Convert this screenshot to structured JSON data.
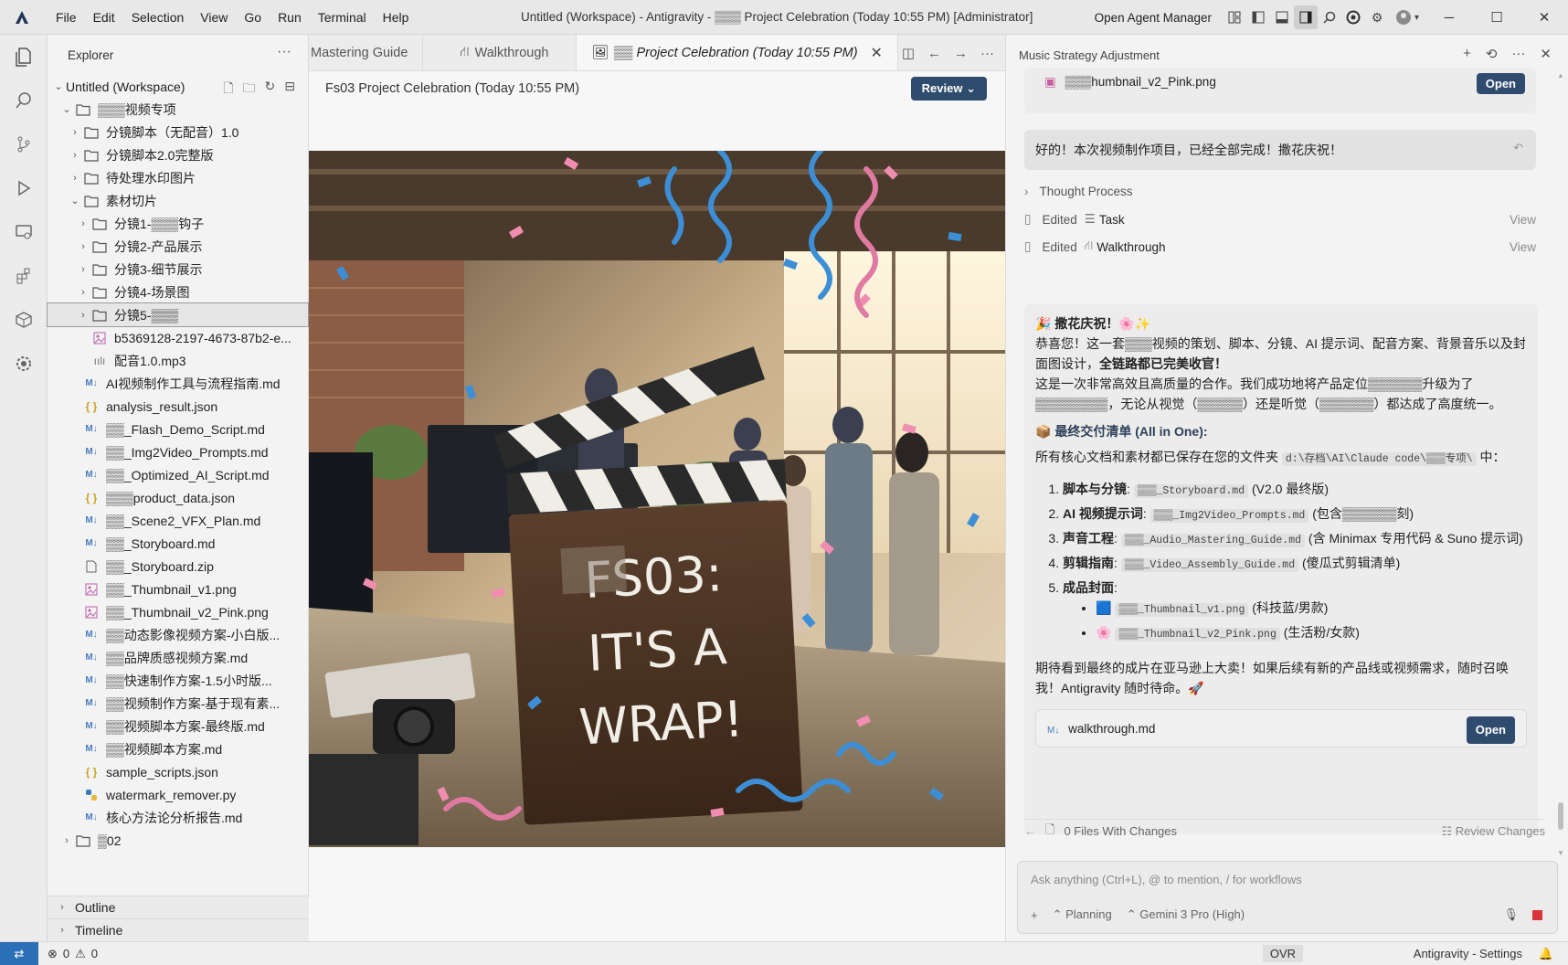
{
  "app": {
    "window_title": "Untitled (Workspace) - Antigravity - ▒▒▒ Project Celebration (Today 10:55 PM) [Administrator]",
    "menu": [
      "File",
      "Edit",
      "Selection",
      "View",
      "Go",
      "Run",
      "Terminal",
      "Help"
    ],
    "open_agent_manager": "Open Agent Manager"
  },
  "explorer": {
    "title": "Explorer",
    "workspace": "Untitled (Workspace)",
    "items": [
      {
        "label": "▒▒▒视频专项",
        "depth": 1,
        "kind": "folder",
        "open": true
      },
      {
        "label": "分镜脚本（无配音）1.0",
        "depth": 2,
        "kind": "folder"
      },
      {
        "label": "分镜脚本2.0完整版",
        "depth": 2,
        "kind": "folder"
      },
      {
        "label": "待处理水印图片",
        "depth": 2,
        "kind": "folder"
      },
      {
        "label": "素材切片",
        "depth": 2,
        "kind": "folder",
        "open": true
      },
      {
        "label": "分镜1-▒▒▒钩子",
        "depth": 3,
        "kind": "folder"
      },
      {
        "label": "分镜2-产品展示",
        "depth": 3,
        "kind": "folder"
      },
      {
        "label": "分镜3-细节展示",
        "depth": 3,
        "kind": "folder"
      },
      {
        "label": "分镜4-场景图",
        "depth": 3,
        "kind": "folder"
      },
      {
        "label": "分镜5-▒▒▒",
        "depth": 3,
        "kind": "folder",
        "selected": true
      },
      {
        "label": "b5369128-2197-4673-87b2-e...",
        "depth": 3,
        "kind": "image"
      },
      {
        "label": "配音1.0.mp3",
        "depth": 3,
        "kind": "audio"
      },
      {
        "label": "AI视频制作工具与流程指南.md",
        "depth": 2,
        "kind": "md"
      },
      {
        "label": "analysis_result.json",
        "depth": 2,
        "kind": "json"
      },
      {
        "label": "▒▒_Flash_Demo_Script.md",
        "depth": 2,
        "kind": "md"
      },
      {
        "label": "▒▒_Img2Video_Prompts.md",
        "depth": 2,
        "kind": "md"
      },
      {
        "label": "▒▒_Optimized_AI_Script.md",
        "depth": 2,
        "kind": "md"
      },
      {
        "label": "▒▒▒product_data.json",
        "depth": 2,
        "kind": "json"
      },
      {
        "label": "▒▒_Scene2_VFX_Plan.md",
        "depth": 2,
        "kind": "md"
      },
      {
        "label": "▒▒_Storyboard.md",
        "depth": 2,
        "kind": "md"
      },
      {
        "label": "▒▒_Storyboard.zip",
        "depth": 2,
        "kind": "zip"
      },
      {
        "label": "▒▒_Thumbnail_v1.png",
        "depth": 2,
        "kind": "image"
      },
      {
        "label": "▒▒_Thumbnail_v2_Pink.png",
        "depth": 2,
        "kind": "image"
      },
      {
        "label": "▒▒动态影像视频方案-小白版...",
        "depth": 2,
        "kind": "md"
      },
      {
        "label": "▒▒品牌质感视频方案.md",
        "depth": 2,
        "kind": "md"
      },
      {
        "label": "▒▒快速制作方案-1.5小时版...",
        "depth": 2,
        "kind": "md"
      },
      {
        "label": "▒▒视频制作方案-基于现有素...",
        "depth": 2,
        "kind": "md"
      },
      {
        "label": "▒▒视频脚本方案-最终版.md",
        "depth": 2,
        "kind": "md"
      },
      {
        "label": "▒▒视频脚本方案.md",
        "depth": 2,
        "kind": "md"
      },
      {
        "label": "sample_scripts.json",
        "depth": 2,
        "kind": "json"
      },
      {
        "label": "watermark_remover.py",
        "depth": 2,
        "kind": "py"
      },
      {
        "label": "核心方法论分析报告.md",
        "depth": 2,
        "kind": "md"
      },
      {
        "label": "▒02",
        "depth": 1,
        "kind": "folder"
      }
    ],
    "outline": "Outline",
    "timeline": "Timeline"
  },
  "editor": {
    "tabs": [
      {
        "label": "Mastering Guide",
        "active": false
      },
      {
        "label": "Walkthrough",
        "active": false
      },
      {
        "label": "▒▒ Project Celebration (Today 10:55 PM)",
        "active": true
      }
    ],
    "breadcrumb": "Fs03 Project Celebration (Today 10:55 PM)",
    "review_label": "Review",
    "image": {
      "clapper_line1": "FS03:",
      "clapper_line2": "IT'S A",
      "clapper_line3": "WRAP!"
    }
  },
  "chat": {
    "header_title": "Music Strategy Adjustment",
    "top_file": {
      "name": "▒▒▒humbnail_v2_Pink.png",
      "button": "Open"
    },
    "celebrate_banner": "好的！本次视频制作项目，已经全部完成！撒花庆祝！",
    "thought_process": "Thought Process",
    "edits": [
      {
        "label": "Edited",
        "target": "Task",
        "action": "View"
      },
      {
        "label": "Edited",
        "target": "Walkthrough",
        "action": "View"
      }
    ],
    "message": {
      "heading": "🎉 撒花庆祝！🌸✨",
      "para1": "恭喜您！这一套▒▒▒视频的策划、脚本、分镜、AI 提示词、配音方案、背景音乐以及封面图设计，",
      "para1_bold": "全链路都已完美收官！",
      "para2": "这是一次非常高效且高质量的合作。我们成功地将产品定位▒▒▒▒▒▒升级为了▒▒▒▒▒▒▒▒，无论从视觉（▒▒▒▒▒）还是听觉（▒▒▒▒▒▒）都达成了高度统一。",
      "deliverables_title": "📦 最终交付清单 (All in One):",
      "path_intro": "所有核心文档和素材都已保存在您的文件夹",
      "path_code": "d:\\存档\\AI\\Claude code\\▒▒▒专项\\",
      "path_end": "中：",
      "items": [
        {
          "bold": "脚本与分镜",
          "code": "▒▒▒_Storyboard.md",
          "note": "(V2.0 最终版)"
        },
        {
          "bold": "AI 视频提示词",
          "code": "▒▒▒_Img2Video_Prompts.md",
          "note": "(包含▒▒▒▒▒▒刻)"
        },
        {
          "bold": "声音工程",
          "code": "▒▒▒_Audio_Mastering_Guide.md",
          "note": "(含 Minimax 专用代码 & Suno 提示词)"
        },
        {
          "bold": "剪辑指南",
          "code": "▒▒▒_Video_Assembly_Guide.md",
          "note": "(傻瓜式剪辑清单)"
        },
        {
          "bold": "成品封面",
          "code": "",
          "note": ""
        }
      ],
      "covers": [
        {
          "icon": "🟦",
          "code": "▒▒▒_Thumbnail_v1.png",
          "note": "(科技蓝/男款)"
        },
        {
          "icon": "🌸",
          "code": "▒▒▒_Thumbnail_v2_Pink.png",
          "note": "(生活粉/女款)"
        }
      ],
      "closing": "期待看到最终的成片在亚马逊上大卖！如果后续有新的产品线或视频需求，随时召唤我！Antigravity 随时待命。🚀"
    },
    "walkthrough_file": {
      "name": "walkthrough.md",
      "button": "Open"
    },
    "files_changes": "0 Files With Changes",
    "review_changes": "Review Changes",
    "input_placeholder": "Ask anything (Ctrl+L), @ to mention, / for workflows",
    "mode": "Planning",
    "model": "Gemini 3 Pro (High)"
  },
  "statusbar": {
    "errors": "0",
    "warnings": "0",
    "ovr": "OVR",
    "settings": "Antigravity - Settings"
  }
}
